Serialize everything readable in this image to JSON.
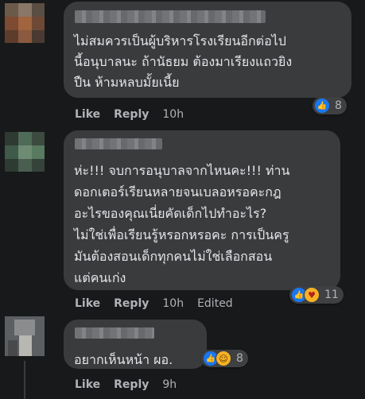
{
  "comments": [
    {
      "text_lines": [
        "ไม่สมควรเป็นผู้บริหารโรงเรียนอีกต่อไป",
        "นี้อนุบาลนะ ถ้านัธยม ต้องมาเรียงแถวยิง",
        "ปืน ห้ามหลบมั้ยเนี้ย"
      ],
      "reaction_count": "8",
      "reactions": [
        "like-icon"
      ],
      "actions": {
        "like": "Like",
        "reply": "Reply",
        "time": "10h"
      }
    },
    {
      "text_lines": [
        "ห่ะ!!! จบการอนุบาลจากไหนคะ!!! ท่าน",
        "ดอกเตอร์เรียนหลายจนเบลอหรอคะกฎ",
        "อะไรของคุณเนี่ยคัดเด็กไปทำอะไร?",
        "ไม่ใช่เพื่อเรียนรู้หรอกหรอคะ การเป็นครู",
        "มันต้องสอนเด็กทุกคนไม่ใช่เลือกสอน",
        "แต่คนเก่ง"
      ],
      "reaction_count": "11",
      "reactions": [
        "like-icon",
        "care-icon"
      ],
      "actions": {
        "like": "Like",
        "reply": "Reply",
        "time": "10h",
        "edited": "Edited"
      }
    },
    {
      "text_lines": [
        "อยากเห็นหน้า ผอ."
      ],
      "reaction_count": "8",
      "reactions": [
        "like-icon",
        "haha-icon"
      ],
      "actions": {
        "like": "Like",
        "reply": "Reply",
        "time": "9h"
      }
    }
  ],
  "colors": {
    "background": "#18191a",
    "bubble": "#3a3b3c",
    "text": "#e4e6eb",
    "muted": "#b0b3b8",
    "like_blue": "#1877f2"
  }
}
